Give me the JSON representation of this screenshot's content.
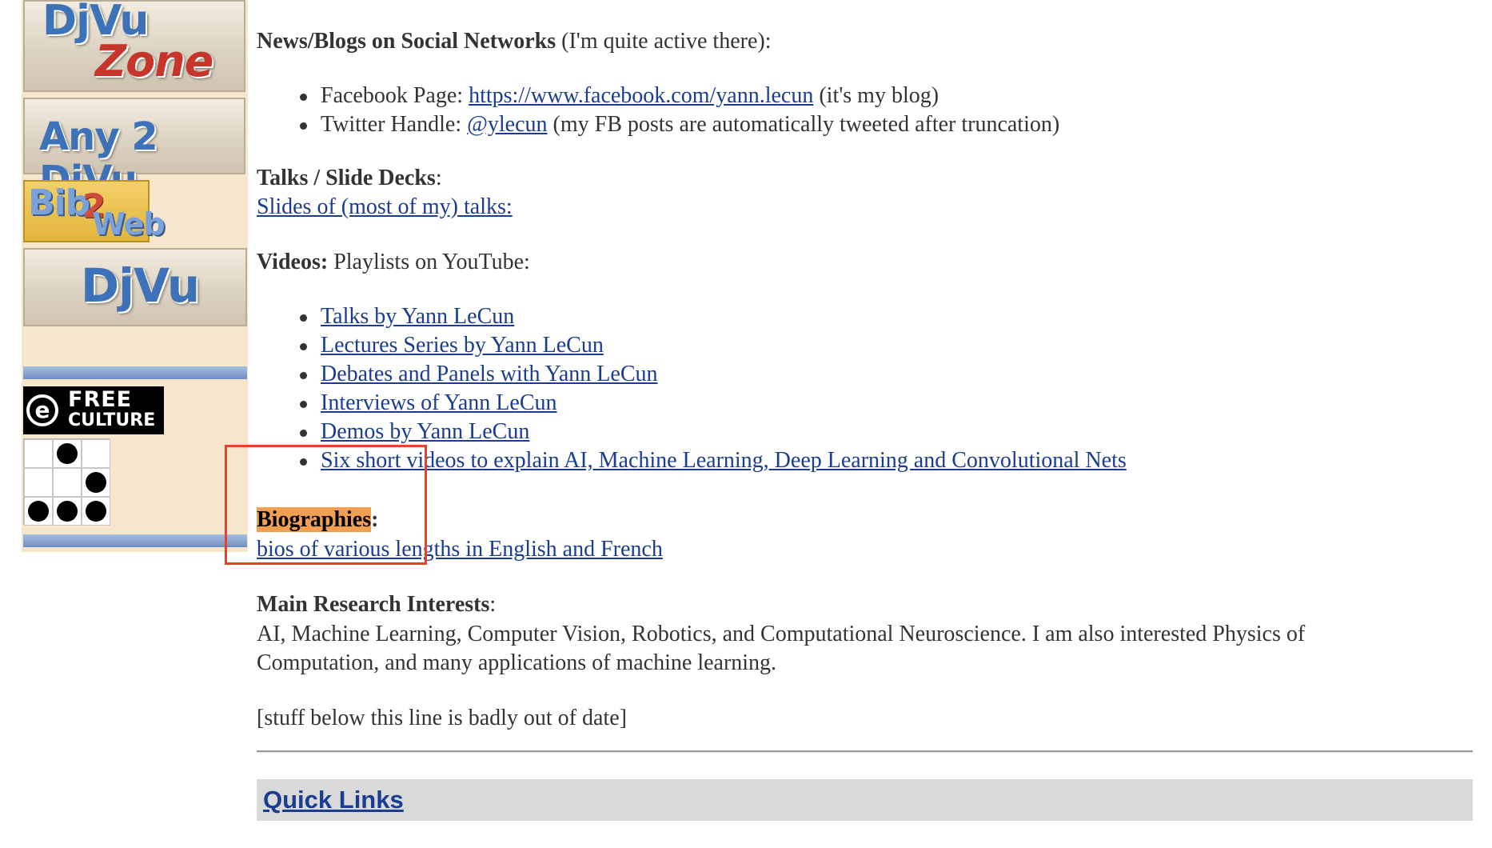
{
  "sidebar": {
    "logos": {
      "djvu_zone_top": "DjVu",
      "djvu_zone_bottom": "Zone",
      "any2djvu": "Any 2 DjVu",
      "bib2web_bib": "Bib",
      "bib2web_two": "2",
      "bib2web_web": "Web",
      "djvu": "DjVu"
    },
    "free_culture": {
      "circle": "e",
      "line1": "FREE",
      "line2": "CULTURE"
    },
    "glider_cells": [
      0,
      1,
      0,
      0,
      0,
      1,
      1,
      1,
      1
    ]
  },
  "news": {
    "heading": "News/Blogs on Social Networks",
    "note": " (I'm quite active there):",
    "items": [
      {
        "label": "Facebook Page: ",
        "link": "https://www.facebook.com/yann.lecun",
        "suffix": " (it's my blog)"
      },
      {
        "label": "Twitter Handle: ",
        "link": "@ylecun",
        "suffix": " (my FB posts are automatically tweeted after truncation)"
      }
    ]
  },
  "talks": {
    "heading": "Talks / Slide Decks",
    "colon": ":",
    "link": "Slides of (most of my) talks:"
  },
  "videos": {
    "heading": "Videos:",
    "note": " Playlists on YouTube:",
    "items": [
      "Talks by Yann LeCun",
      "Lectures Series by Yann LeCun",
      "Debates and Panels with Yann LeCun",
      "Interviews of Yann LeCun",
      "Demos by Yann LeCun",
      "Six short videos to explain AI, Machine Learning, Deep Learning and Convolutional Nets"
    ]
  },
  "biographies": {
    "heading": "Biographies",
    "colon": ":",
    "link": "bios of various lengths in English and French"
  },
  "research": {
    "heading": "Main Research Interests",
    "colon": ":",
    "line1": "AI, Machine Learning, Computer Vision, Robotics, and Computational Neuroscience. I am also interested Physics of",
    "line2": "Computation, and many applications of machine learning."
  },
  "notice": "[stuff below this line is badly out of date]",
  "quick_links": "Quick Links",
  "colors": {
    "link": "#1a3d8f",
    "highlight": "#f0a050",
    "annotation_box": "#e8412a",
    "sidebar_bg": "#f5e6cc"
  }
}
